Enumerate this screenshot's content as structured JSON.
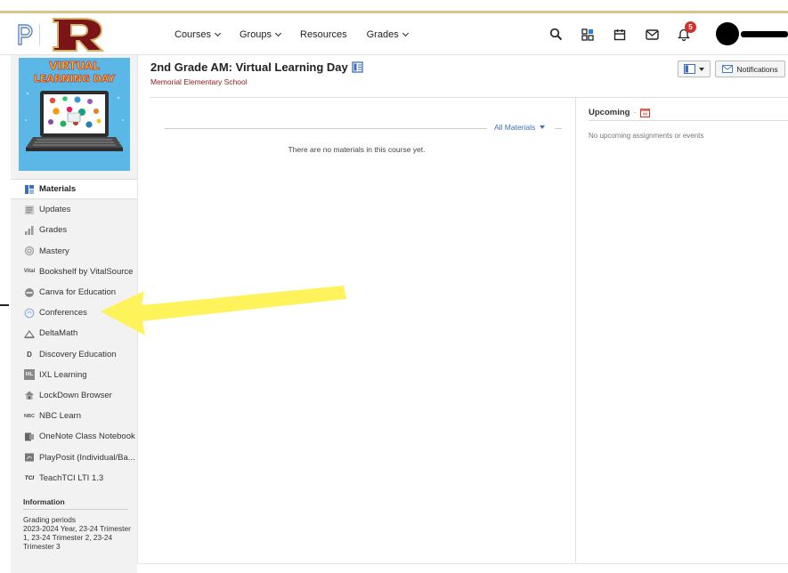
{
  "topnav": {
    "items": [
      {
        "label": "Courses",
        "has_dropdown": true
      },
      {
        "label": "Groups",
        "has_dropdown": true
      },
      {
        "label": "Resources",
        "has_dropdown": false
      },
      {
        "label": "Grades",
        "has_dropdown": true
      }
    ],
    "icons": [
      "search-icon",
      "apps-icon",
      "calendar-icon",
      "mail-icon",
      "bell-icon"
    ],
    "notification_count": "5",
    "accent_color": "#d9c58a",
    "brand_red": "#7b1416"
  },
  "course_image": {
    "line1": "VIRTUAL",
    "line2": "LEARNING DAY",
    "bg_color": "#5bb8e6"
  },
  "sidebar": {
    "items": [
      {
        "label": "Materials",
        "icon": "materials-icon",
        "active": true
      },
      {
        "label": "Updates",
        "icon": "updates-icon",
        "active": false
      },
      {
        "label": "Grades",
        "icon": "grades-icon",
        "active": false
      },
      {
        "label": "Mastery",
        "icon": "mastery-icon",
        "active": false
      },
      {
        "label": "Bookshelf by VitalSource",
        "icon": "vitalsource-icon",
        "active": false
      },
      {
        "label": "Canva for Education",
        "icon": "canva-icon",
        "active": false
      },
      {
        "label": "Conferences",
        "icon": "conferences-icon",
        "active": false
      },
      {
        "label": "DeltaMath",
        "icon": "deltamath-icon",
        "active": false
      },
      {
        "label": "Discovery Education",
        "icon": "discovery-icon",
        "active": false
      },
      {
        "label": "IXL Learning",
        "icon": "ixl-icon",
        "active": false
      },
      {
        "label": "LockDown Browser",
        "icon": "lockdown-icon",
        "active": false
      },
      {
        "label": "NBC Learn",
        "icon": "nbc-icon",
        "active": false
      },
      {
        "label": "OneNote Class Notebook",
        "icon": "onenote-icon",
        "active": false
      },
      {
        "label": "PlayPosit (Individual/Ba...",
        "icon": "playposit-icon",
        "active": false
      },
      {
        "label": "TeachTCI LTI 1.3",
        "icon": "tci-icon",
        "active": false
      }
    ],
    "icon_text": {
      "vital": "Vital",
      "ixl": "IXL",
      "nbc": "NBC",
      "tci": "TCI",
      "discovery": "D"
    },
    "info": {
      "heading": "Information",
      "label": "Grading periods",
      "value": "2023-2024 Year, 23-24 Trimester 1, 23-24 Trimester 2, 23-24 Trimester 3"
    }
  },
  "main": {
    "course_title": "2nd Grade AM: Virtual Learning Day",
    "school": "Memorial Elementary School",
    "notifications_label": "Notifications",
    "filter_label": "All Materials",
    "empty_message": "There are no materials in this course yet.",
    "upcoming_title": "Upcoming",
    "upcoming_separator": "·",
    "upcoming_empty": "No upcoming assignments or events",
    "link_color": "#3c72b8",
    "school_color": "#8a1a1a"
  },
  "annotation": {
    "type": "arrow",
    "color": "#fff35c",
    "points_to": "Conferences"
  }
}
